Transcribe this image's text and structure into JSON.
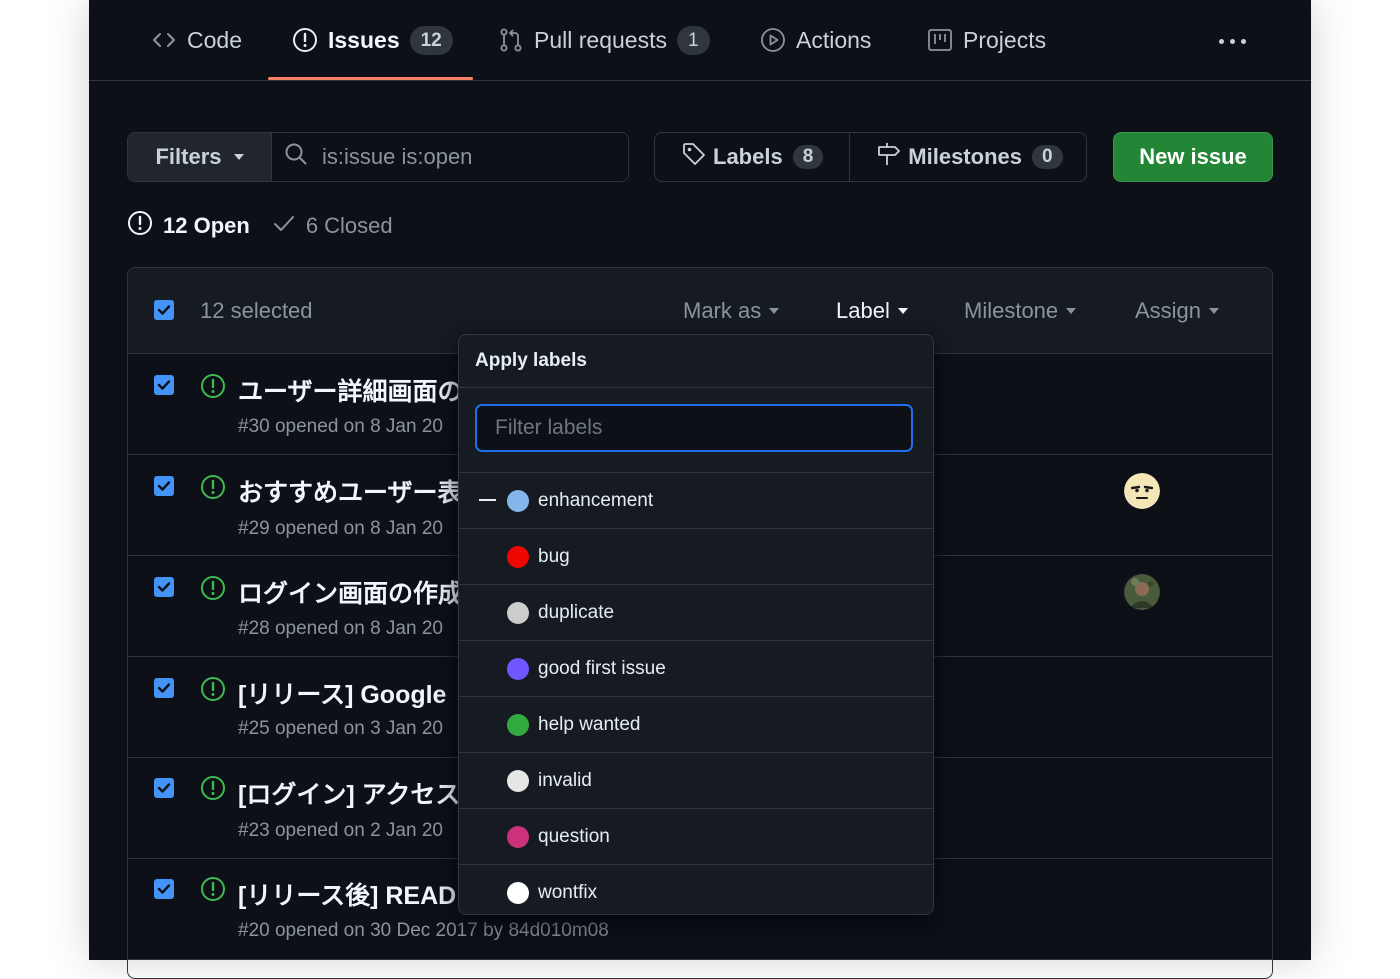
{
  "tabs": [
    {
      "label": "Code",
      "icon": "code-icon"
    },
    {
      "label": "Issues",
      "count": "12",
      "icon": "issue-opened-icon",
      "selected": true
    },
    {
      "label": "Pull requests",
      "count": "1",
      "icon": "git-pull-request-icon"
    },
    {
      "label": "Actions",
      "icon": "play-icon"
    },
    {
      "label": "Projects",
      "icon": "project-icon"
    }
  ],
  "toolbar": {
    "filters_label": "Filters",
    "search_value": "is:issue is:open",
    "labels_label": "Labels",
    "labels_count": "8",
    "milestones_label": "Milestones",
    "milestones_count": "0",
    "new_issue_label": "New issue"
  },
  "states": {
    "open": "12 Open",
    "closed": "6 Closed"
  },
  "list_header": {
    "selected": "12 selected",
    "mark_as": "Mark as",
    "label": "Label",
    "milestone": "Milestone",
    "assign": "Assign"
  },
  "issues": [
    {
      "title": "ユーザー詳細画面の",
      "meta": "#30 opened on 8 Jan 20"
    },
    {
      "title": "おすすめユーザー表",
      "meta": "#29 opened on 8 Jan 20"
    },
    {
      "title": "ログイン画面の作成",
      "meta": "#28 opened on 8 Jan 20"
    },
    {
      "title": "[リリース] Google",
      "meta": "#25 opened on 3 Jan 20"
    },
    {
      "title": "[ログイン] アクセス",
      "meta": "#23 opened on 2 Jan 20"
    },
    {
      "title": "[リリース後] READ",
      "meta": "#20 opened on 30 Dec 2017 by 84d010m08"
    }
  ],
  "dropdown": {
    "title": "Apply labels",
    "filter_placeholder": "Filter labels",
    "labels": [
      {
        "name": "enhancement",
        "color": "#84b6eb",
        "partial": true
      },
      {
        "name": "bug",
        "color": "#ee0701",
        "partial": false
      },
      {
        "name": "duplicate",
        "color": "#cccccc",
        "partial": false
      },
      {
        "name": "good first issue",
        "color": "#7057ff",
        "partial": false
      },
      {
        "name": "help wanted",
        "color": "#33aa3f",
        "partial": false
      },
      {
        "name": "invalid",
        "color": "#e6e6e6",
        "partial": false
      },
      {
        "name": "question",
        "color": "#cc317c",
        "partial": false
      },
      {
        "name": "wontfix",
        "color": "#ffffff",
        "partial": false
      }
    ]
  },
  "colors": {
    "accent": "#f78166",
    "primary_button": "#238636",
    "checkbox": "#4493f8",
    "open_issue": "#3fb950"
  }
}
